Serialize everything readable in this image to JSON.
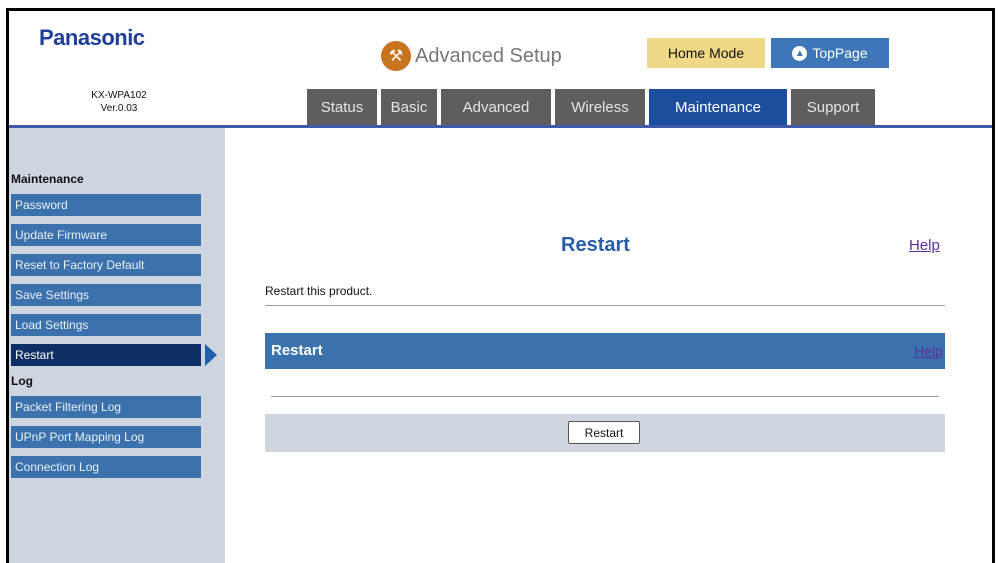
{
  "header": {
    "logo": "Panasonic",
    "model": "KX-WPA102",
    "version": "Ver.0.03",
    "advanced_setup": "Advanced Setup",
    "home_mode": "Home Mode",
    "top_page": "TopPage"
  },
  "tabs": [
    {
      "label": "Status",
      "active": false
    },
    {
      "label": "Basic",
      "active": false
    },
    {
      "label": "Advanced",
      "active": false
    },
    {
      "label": "Wireless",
      "active": false
    },
    {
      "label": "Maintenance",
      "active": true
    },
    {
      "label": "Support",
      "active": false
    }
  ],
  "sidebar": {
    "maintenance_title": "Maintenance",
    "maintenance_items": [
      {
        "label": "Password"
      },
      {
        "label": "Update Firmware"
      },
      {
        "label": "Reset to Factory Default"
      },
      {
        "label": "Save Settings"
      },
      {
        "label": "Load Settings"
      },
      {
        "label": "Restart",
        "active": true
      }
    ],
    "log_title": "Log",
    "log_items": [
      {
        "label": "Packet Filtering Log"
      },
      {
        "label": "UPnP Port Mapping Log"
      },
      {
        "label": "Connection Log"
      }
    ]
  },
  "main": {
    "title": "Restart",
    "help": "Help",
    "description": "Restart this product.",
    "section_title": "Restart",
    "section_help": "Help",
    "restart_button": "Restart"
  },
  "colors": {
    "accent": "#3b72ad",
    "active_tab": "#1d4e9e",
    "tab_bg": "#5e5e5e",
    "sidebar_bg": "#cdd5df",
    "home_mode_bg": "#efd988",
    "link": "#5a2f9a"
  },
  "icons": {
    "advanced_setup": "wrench-icon",
    "top_page": "arrow-up-circle-icon",
    "active_nav": "triangle-right-icon"
  }
}
